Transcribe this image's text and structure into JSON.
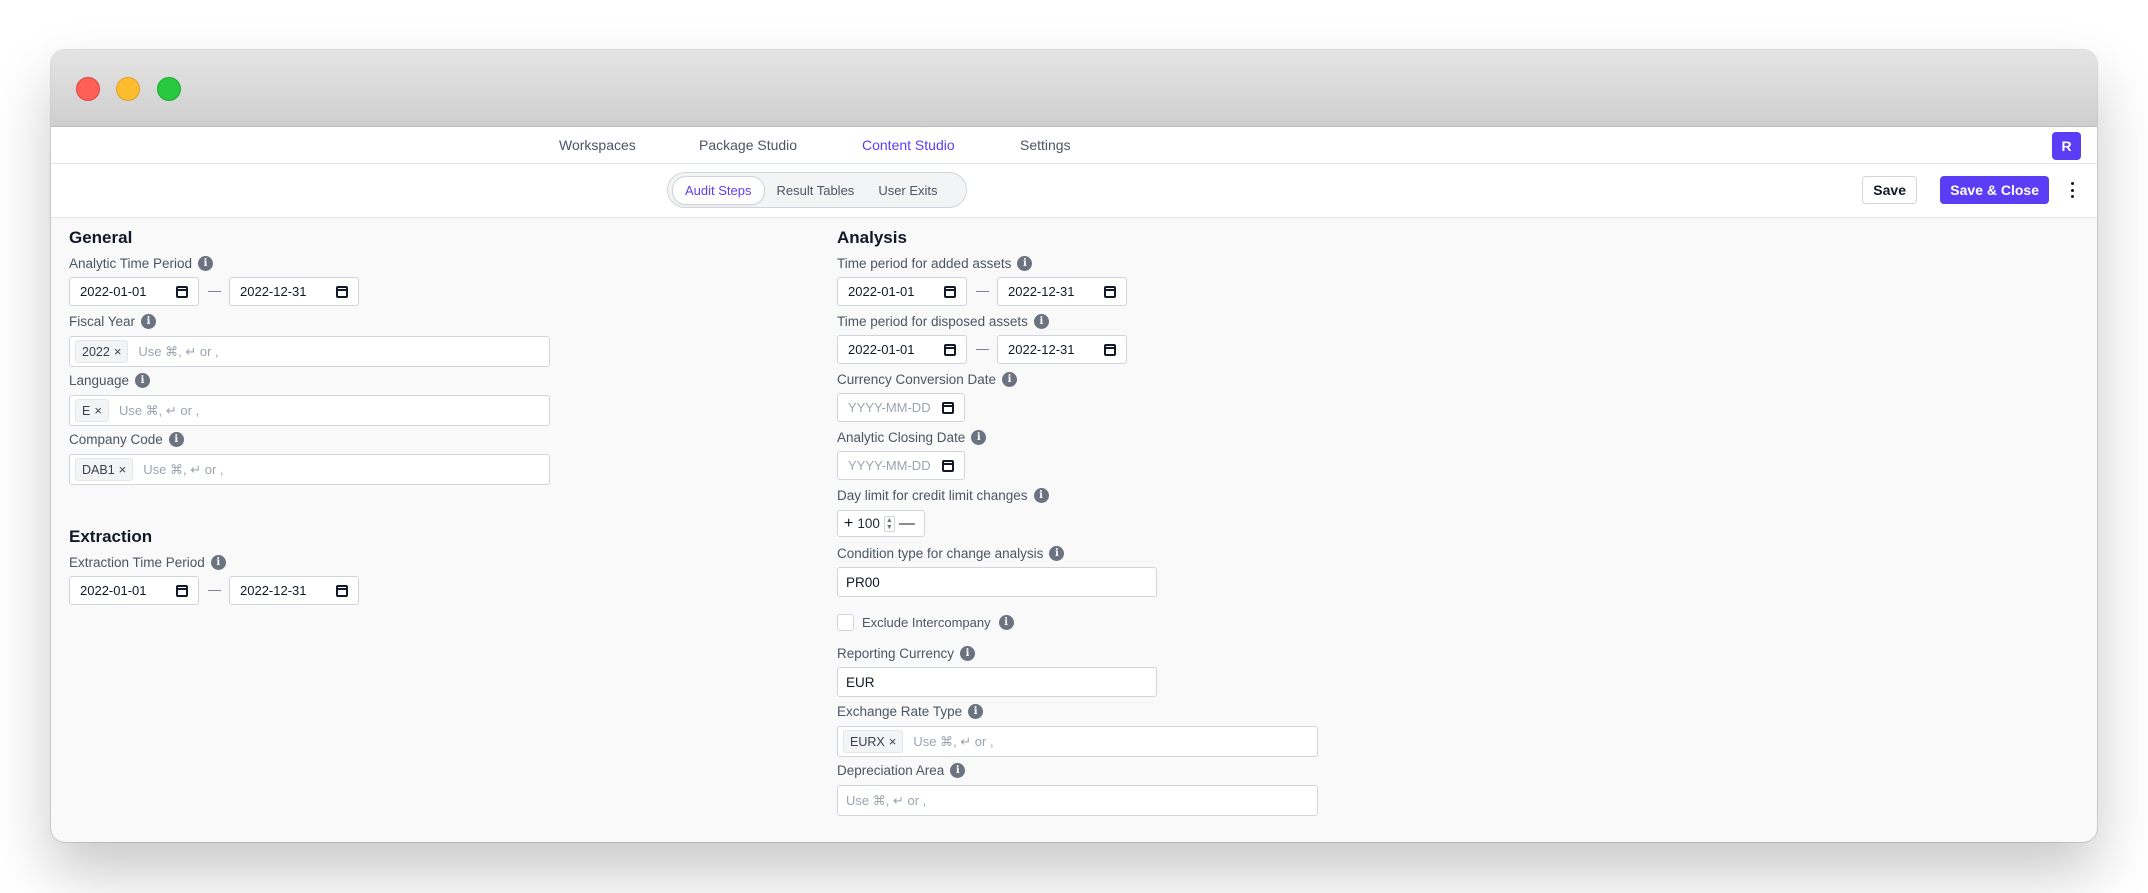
{
  "nav": {
    "items": [
      "Workspaces",
      "Package Studio",
      "Content Studio",
      "Settings"
    ],
    "active": "Content Studio",
    "avatar": "R"
  },
  "toolbar": {
    "tabs": [
      "Audit Steps",
      "Result Tables",
      "User Exits"
    ],
    "active_tab": "Audit Steps",
    "save_label": "Save",
    "save_close_label": "Save & Close"
  },
  "general": {
    "title": "General",
    "analytic_time_period": {
      "label": "Analytic Time Period",
      "from": "2022-01-01",
      "to": "2022-12-31"
    },
    "fiscal_year": {
      "label": "Fiscal Year",
      "chips": [
        "2022"
      ],
      "placeholder": "Use ⌘, ↵ or ,"
    },
    "language": {
      "label": "Language",
      "chips": [
        "E"
      ],
      "placeholder": "Use ⌘, ↵ or ,"
    },
    "company_code": {
      "label": "Company Code",
      "chips": [
        "DAB1"
      ],
      "placeholder": "Use ⌘, ↵ or ,"
    }
  },
  "extraction": {
    "title": "Extraction",
    "time_period": {
      "label": "Extraction Time Period",
      "from": "2022-01-01",
      "to": "2022-12-31"
    }
  },
  "analysis": {
    "title": "Analysis",
    "added_assets": {
      "label": "Time period for added assets",
      "from": "2022-01-01",
      "to": "2022-12-31"
    },
    "disposed_assets": {
      "label": "Time period for disposed assets",
      "from": "2022-01-01",
      "to": "2022-12-31"
    },
    "currency_conversion_date": {
      "label": "Currency Conversion Date",
      "placeholder": "YYYY-MM-DD"
    },
    "analytic_closing_date": {
      "label": "Analytic Closing Date",
      "placeholder": "YYYY-MM-DD"
    },
    "day_limit": {
      "label": "Day limit for credit limit changes",
      "value": "100"
    },
    "condition_type": {
      "label": "Condition type for change analysis",
      "value": "PR00"
    },
    "exclude_intercompany": {
      "label": "Exclude Intercompany",
      "checked": false
    },
    "reporting_currency": {
      "label": "Reporting Currency",
      "value": "EUR"
    },
    "exchange_rate_type": {
      "label": "Exchange Rate Type",
      "chips": [
        "EURX"
      ],
      "placeholder": "Use ⌘, ↵ or ,"
    },
    "depreciation_area": {
      "label": "Depreciation Area",
      "placeholder": "Use ⌘, ↵ or ,"
    }
  },
  "icons": {
    "info": "i",
    "chip_remove": "×",
    "dash": "—",
    "plus": "+",
    "minus": "—"
  }
}
